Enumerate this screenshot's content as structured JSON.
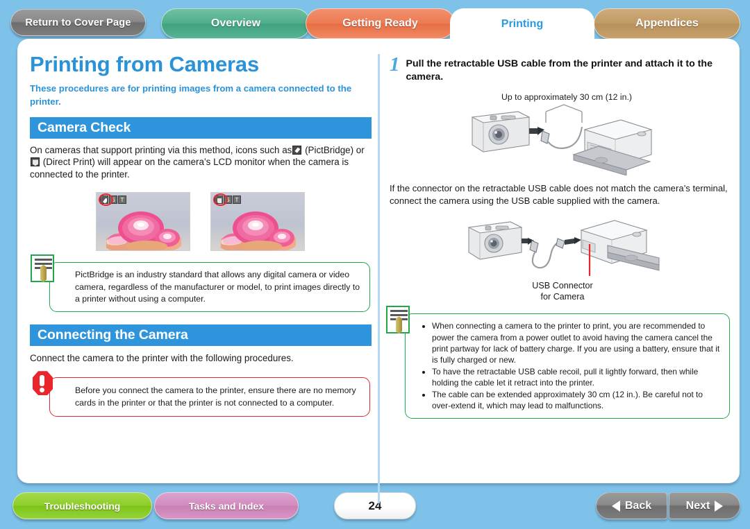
{
  "topbar": {
    "cover_button": "Return to Cover Page",
    "tabs": [
      {
        "label": "Overview",
        "color": "#4fad8b",
        "active": false
      },
      {
        "label": "Getting Ready",
        "color": "#ec7a52",
        "active": false
      },
      {
        "label": "Printing",
        "color": "#2a9ae0",
        "active": true
      },
      {
        "label": "Appendices",
        "color": "#c09a63",
        "active": false
      }
    ]
  },
  "left": {
    "title": "Printing from Cameras",
    "subtitle": "These procedures are for printing images from a camera connected to the printer.",
    "section1_heading": "Camera Check",
    "body_part1": "On cameras that support printing via this method, icons such as",
    "body_part2": "(PictBridge) or",
    "body_part3": "(Direct Print) will appear on the camera’s LCD monitor when the camera is connected to the printer.",
    "thumb_badges": [
      {
        "icon": "pictbridge-icon",
        "s": "S",
        "t": "T"
      },
      {
        "icon": "direct-print-icon",
        "s": "S",
        "t": "T"
      }
    ],
    "note": "PictBridge is an industry standard that allows any digital camera or video camera, regardless of the manufacturer or model, to print images directly to a printer without using a computer.",
    "section2_heading": "Connecting the Camera",
    "section2_body": "Connect the camera to the printer with the following procedures.",
    "warning": "Before you connect the camera to the printer, ensure there are no memory cards in the printer or that the printer is not connected to a computer."
  },
  "right": {
    "step_number": "1",
    "step_text": "Pull the retractable USB cable from the printer and attach it to the camera.",
    "figure1_caption": "Up to approximately 30 cm (12 in.)",
    "paragraph": "If the connector on the retractable USB cable does not match the camera’s terminal, connect the camera using the USB cable supplied with the camera.",
    "figure2_label_line1": "USB Connector",
    "figure2_label_line2": "for Camera",
    "notes": [
      "When connecting a camera to the printer to print, you are recommended to power the camera from a power outlet to avoid having the camera cancel the print partway for lack of battery charge. If you are using a battery, ensure that it is fully charged or new.",
      "To have the retractable USB cable recoil, pull it lightly forward, then while holding the cable let it retract into the printer.",
      "The cable can be extended approximately 30 cm (12 in.). Be careful not to over-extend it, which may lead to malfunctions."
    ]
  },
  "bottom": {
    "troubleshooting": "Troubleshooting",
    "tasks_and_index": "Tasks and Index",
    "page_number": "24",
    "back": "Back",
    "next": "Next"
  }
}
